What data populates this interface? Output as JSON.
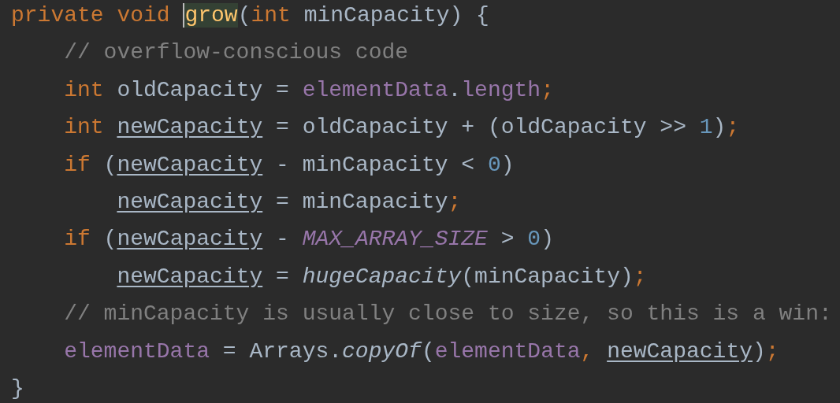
{
  "editor": {
    "lines": [
      {
        "kind": "top",
        "tokens": [
          {
            "text": "private void ",
            "kind": "keyword"
          },
          {
            "text": "grow",
            "kind": "method-highlighted"
          },
          {
            "text": "(",
            "kind": "plain"
          },
          {
            "text": "int ",
            "kind": "keyword"
          },
          {
            "text": "minCapacity) {",
            "kind": "plain"
          }
        ]
      },
      {
        "kind": "body",
        "tokens": [
          {
            "text": "// overflow-conscious code",
            "kind": "comment"
          }
        ]
      },
      {
        "kind": "body",
        "tokens": [
          {
            "text": "int ",
            "kind": "keyword"
          },
          {
            "text": "oldCapacity = ",
            "kind": "plain"
          },
          {
            "text": "elementData",
            "kind": "field"
          },
          {
            "text": ".",
            "kind": "plain"
          },
          {
            "text": "length",
            "kind": "field"
          },
          {
            "text": ";",
            "kind": "keyword"
          }
        ]
      },
      {
        "kind": "body",
        "tokens": [
          {
            "text": "int ",
            "kind": "keyword"
          },
          {
            "text": "newCapacity",
            "kind": "reassigned"
          },
          {
            "text": " = oldCapacity + (oldCapacity >> ",
            "kind": "plain"
          },
          {
            "text": "1",
            "kind": "number"
          },
          {
            "text": ")",
            "kind": "plain"
          },
          {
            "text": ";",
            "kind": "keyword"
          }
        ]
      },
      {
        "kind": "body",
        "tokens": [
          {
            "text": "if ",
            "kind": "keyword"
          },
          {
            "text": "(",
            "kind": "plain"
          },
          {
            "text": "newCapacity",
            "kind": "reassigned"
          },
          {
            "text": " - minCapacity < ",
            "kind": "plain"
          },
          {
            "text": "0",
            "kind": "number"
          },
          {
            "text": ")",
            "kind": "plain"
          }
        ]
      },
      {
        "kind": "nested",
        "tokens": [
          {
            "text": "newCapacity",
            "kind": "reassigned"
          },
          {
            "text": " = minCapacity",
            "kind": "plain"
          },
          {
            "text": ";",
            "kind": "keyword"
          }
        ]
      },
      {
        "kind": "body",
        "tokens": [
          {
            "text": "if ",
            "kind": "keyword"
          },
          {
            "text": "(",
            "kind": "plain"
          },
          {
            "text": "newCapacity",
            "kind": "reassigned"
          },
          {
            "text": " - ",
            "kind": "plain"
          },
          {
            "text": "MAX_ARRAY_SIZE",
            "kind": "constant"
          },
          {
            "text": " > ",
            "kind": "plain"
          },
          {
            "text": "0",
            "kind": "number"
          },
          {
            "text": ")",
            "kind": "plain"
          }
        ]
      },
      {
        "kind": "nested",
        "tokens": [
          {
            "text": "newCapacity",
            "kind": "reassigned"
          },
          {
            "text": " = ",
            "kind": "plain"
          },
          {
            "text": "hugeCapacity",
            "kind": "static-call"
          },
          {
            "text": "(minCapacity)",
            "kind": "plain"
          },
          {
            "text": ";",
            "kind": "keyword"
          }
        ]
      },
      {
        "kind": "body",
        "tokens": [
          {
            "text": "// minCapacity is usually close to size, so this is a win:",
            "kind": "comment"
          }
        ]
      },
      {
        "kind": "body",
        "tokens": [
          {
            "text": "elementData",
            "kind": "field"
          },
          {
            "text": " = Arrays.",
            "kind": "plain"
          },
          {
            "text": "copyOf",
            "kind": "static-call"
          },
          {
            "text": "(",
            "kind": "plain"
          },
          {
            "text": "elementData",
            "kind": "field"
          },
          {
            "text": ", ",
            "kind": "keyword"
          },
          {
            "text": "newCapacity",
            "kind": "reassigned"
          },
          {
            "text": ")",
            "kind": "plain"
          },
          {
            "text": ";",
            "kind": "keyword"
          }
        ]
      },
      {
        "kind": "top",
        "tokens": [
          {
            "text": "}",
            "kind": "plain"
          }
        ]
      }
    ]
  }
}
